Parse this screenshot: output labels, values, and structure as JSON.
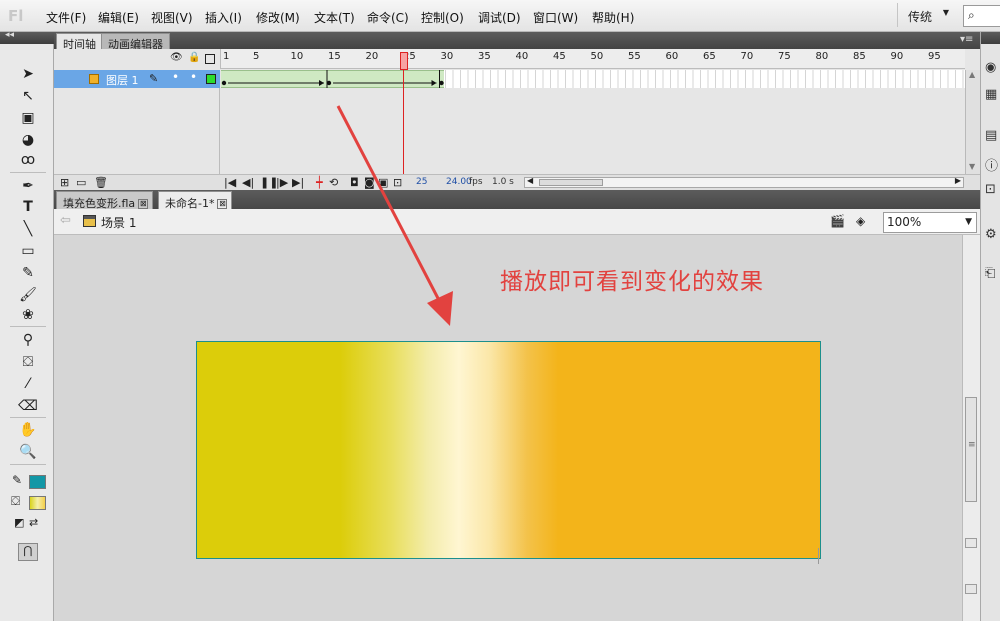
{
  "app": {
    "logo": "Fl"
  },
  "menu": [
    "文件(F)",
    "编辑(E)",
    "视图(V)",
    "插入(I)",
    "修改(M)",
    "文本(T)",
    "命令(C)",
    "控制(O)",
    "调试(D)",
    "窗口(W)",
    "帮助(H)"
  ],
  "workspace": {
    "label": "传统",
    "dropdown": "▼"
  },
  "search": {
    "icon": "⌕"
  },
  "timeline_panel": {
    "tabs": [
      "时间轴",
      "动画编辑器"
    ],
    "ruler_marks": [
      "1",
      "5",
      "10",
      "15",
      "20",
      "25",
      "30",
      "35",
      "40",
      "45",
      "50",
      "55",
      "60",
      "65",
      "70",
      "75",
      "80",
      "85",
      "90",
      "95"
    ],
    "layer": {
      "name": "图层 1"
    },
    "footer": {
      "current_frame": "25",
      "fps": "24.00",
      "fps_unit": "fps",
      "time": "1.0 s"
    },
    "playhead_frame": 25,
    "keyframes": [
      1,
      15,
      30
    ],
    "tween_range": [
      1,
      30
    ]
  },
  "document_tabs": [
    {
      "label": "填充色变形.fla",
      "close": "⊠"
    },
    {
      "label": "未命名-1*",
      "close": "⊠"
    }
  ],
  "editbar": {
    "scene": "场景 1",
    "zoom": "100%"
  },
  "stage": {
    "annotation": "播放即可看到变化的效果",
    "gradient_colors": [
      "#dccd0a",
      "#fff6d2",
      "#f3b41a"
    ]
  },
  "colors": {
    "stroke_color": "#1297a6",
    "annotation_color": "#e2423f",
    "tween_color": "#cfe9c3",
    "layer_selected": "#6aa6e6"
  }
}
